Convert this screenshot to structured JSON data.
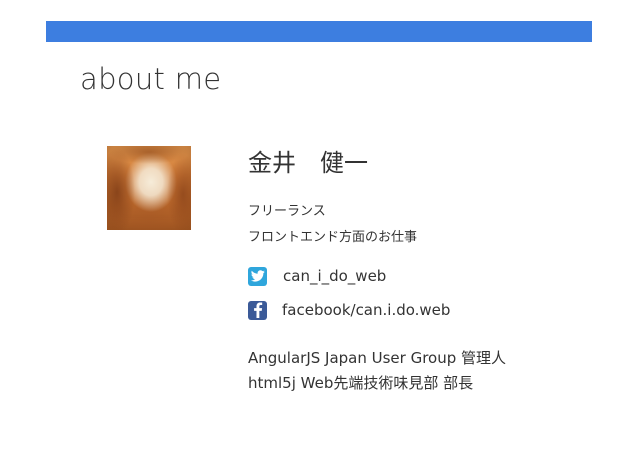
{
  "slide": {
    "title": "about me",
    "accent_color": "#3d7ee0"
  },
  "profile": {
    "avatar_icon": "profile-photo",
    "name": "金井　健一",
    "roles": [
      "フリーランス",
      "フロントエンド方面のお仕事"
    ],
    "social": {
      "twitter": {
        "icon": "twitter-bird-icon",
        "handle": "can_i_do_web",
        "color": "#2fa6dc"
      },
      "facebook": {
        "icon": "facebook-f-icon",
        "handle": "facebook/can.i.do.web",
        "color": "#3b5a98"
      }
    },
    "groups": [
      "AngularJS Japan User Group 管理人",
      "html5j Web先端技術味見部 部長"
    ]
  }
}
